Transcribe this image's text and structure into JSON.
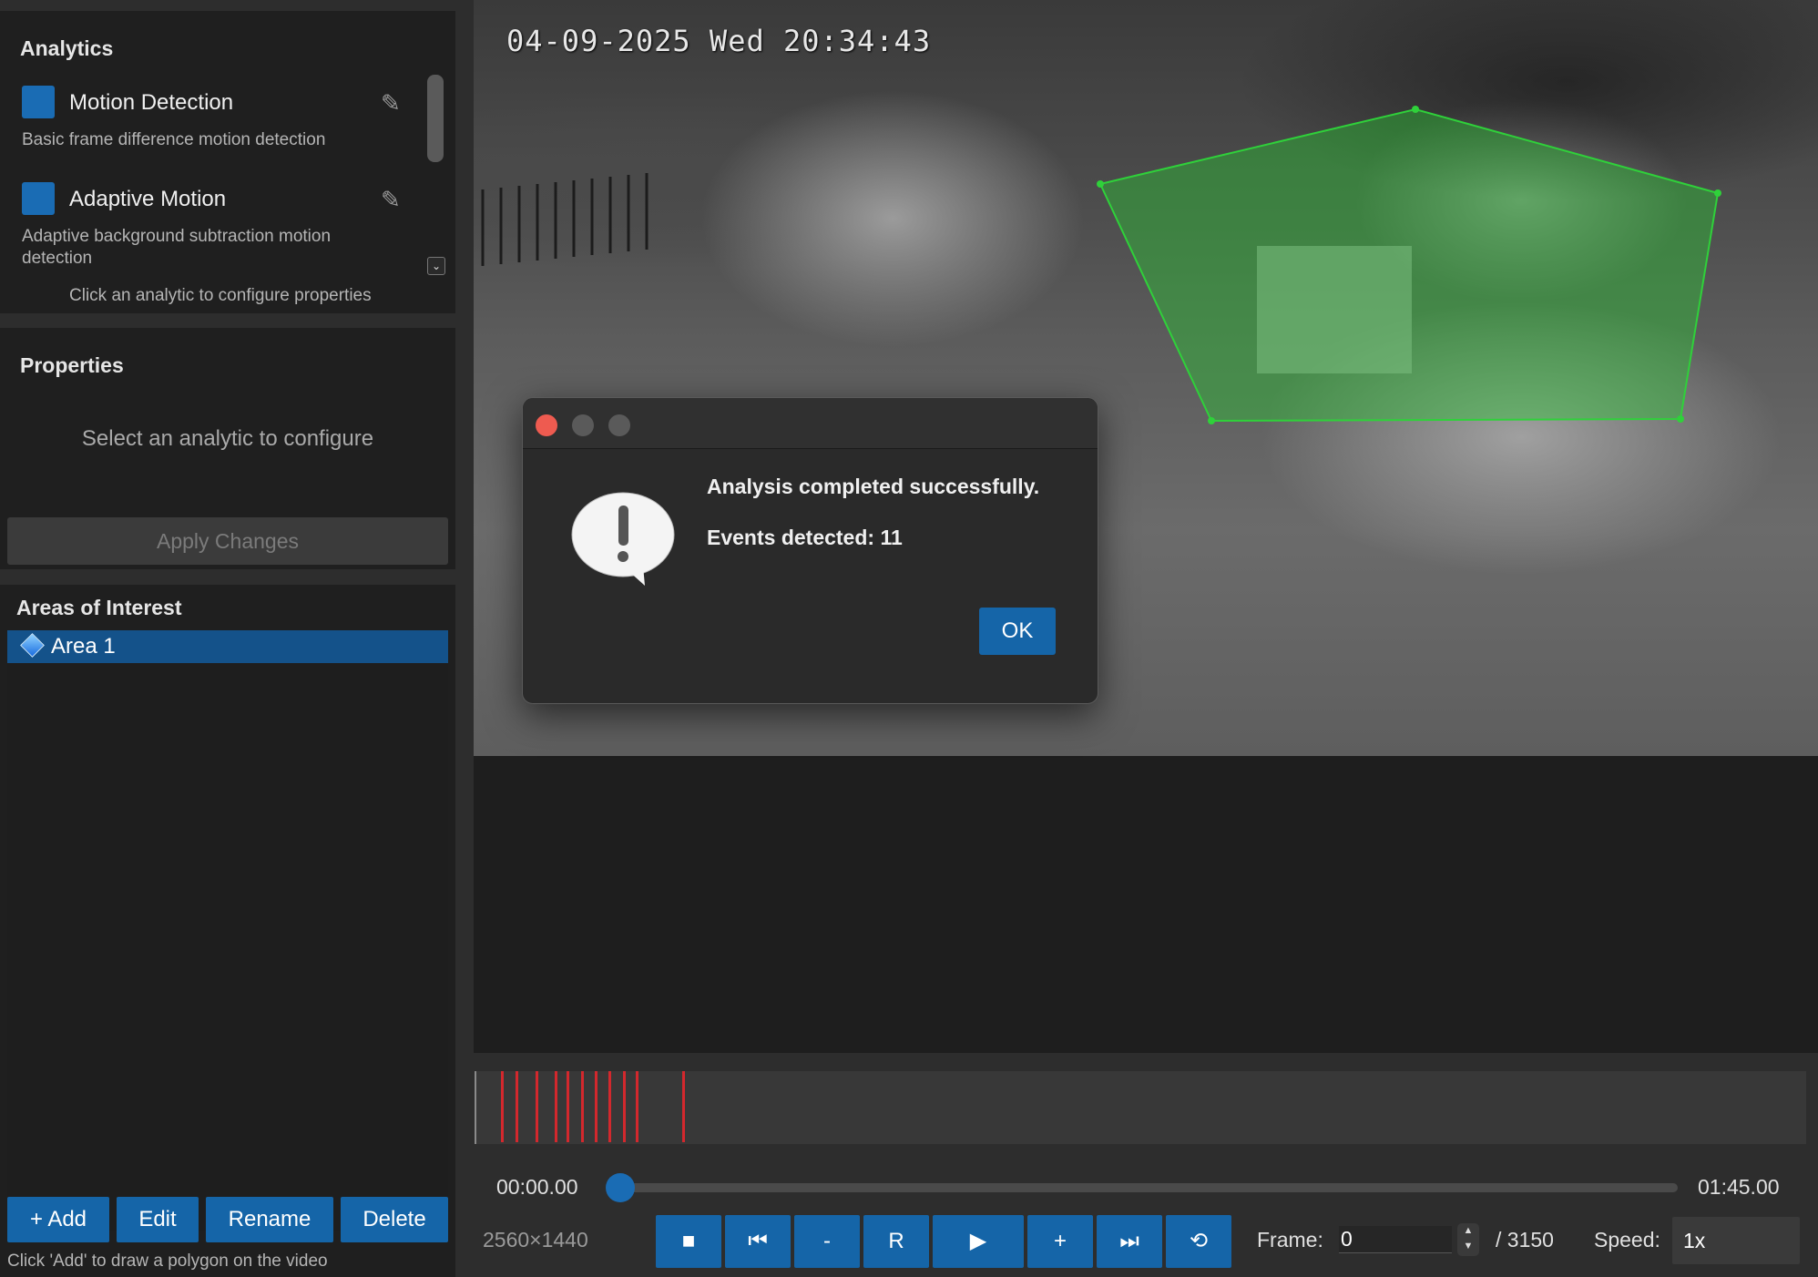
{
  "analytics": {
    "title": "Analytics",
    "items": [
      {
        "name": "Motion Detection",
        "description": "Basic frame difference motion detection",
        "swatch_color": "#1a6cb4"
      },
      {
        "name": "Adaptive Motion",
        "description": "Adaptive background subtraction motion detection",
        "swatch_color": "#1a6cb4"
      }
    ],
    "hint": "Click an analytic to configure properties"
  },
  "properties": {
    "title": "Properties",
    "placeholder": "Select an analytic to configure",
    "apply_label": "Apply Changes"
  },
  "areas": {
    "title": "Areas of Interest",
    "items": [
      {
        "label": "Area 1",
        "selected": true
      }
    ],
    "buttons": {
      "add": "+ Add",
      "edit": "Edit",
      "rename": "Rename",
      "delete": "Delete"
    },
    "hint": "Click 'Add' to draw a polygon on the video"
  },
  "video": {
    "timestamp_overlay": "04-09-2025 Wed 20:34:43",
    "aoi_polygon_color": "#2fd13a"
  },
  "timeline": {
    "event_marker_color": "#d3282d",
    "event_count_shown": 11
  },
  "playback": {
    "current_time": "00:00.00",
    "total_time": "01:45.00",
    "progress_fraction": 0,
    "resolution": "2560×1440",
    "buttons": {
      "stop": "■",
      "prev": "⏮",
      "minus": "-",
      "reset": "R",
      "play": "▶",
      "plus": "+",
      "next": "⏭",
      "loop": "⟲"
    },
    "frame_label": "Frame:",
    "frame_value": "0",
    "frame_total": "/ 3150",
    "speed_label": "Speed:",
    "speed_value": "1x"
  },
  "dialog": {
    "message": "Analysis completed successfully.",
    "events": "Events detected: 11",
    "ok_label": "OK",
    "icon": "alert-speech-bubble-icon"
  },
  "colors": {
    "accent": "#1565a8",
    "panel_bg": "#1f1f1f",
    "window_bg": "#2d2d2d"
  }
}
